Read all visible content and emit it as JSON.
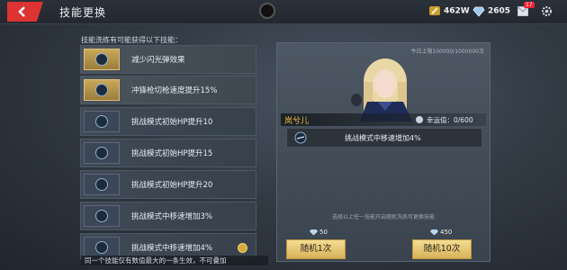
{
  "header": {
    "title": "技能更换",
    "currency_gold": "462W",
    "currency_gem": "2605",
    "mail_badge": "17"
  },
  "left": {
    "heading": "技能洗练有可能获得以下技能：",
    "skills": [
      {
        "label": "减少闪光弹效果",
        "active": true
      },
      {
        "label": "冲锋枪切枪速度提升15%",
        "active": true
      },
      {
        "label": "挑战模式初始HP提升10",
        "active": false
      },
      {
        "label": "挑战模式初始HP提升15",
        "active": false
      },
      {
        "label": "挑战模式初始HP提升20",
        "active": false
      },
      {
        "label": "挑战模式中移速增加3%",
        "active": false
      },
      {
        "label": "挑战模式中移速增加4%",
        "active": false
      }
    ],
    "footer_note": "同一个技能仅有数值最大的一条生效，不可叠加"
  },
  "right": {
    "draw_counter": "今日上限100000/1000000次",
    "character_name": "岚兮儿",
    "luck": "幸运值：0/600",
    "result_skill": "挑战模式中移速增加4%",
    "hint": "选择以上任一技能开启随机洗练可更换技能",
    "cost_1": "50",
    "cost_10": "450",
    "btn_1": "随机1次",
    "btn_10": "随机10次"
  },
  "colors": {
    "accent_red": "#dd3333",
    "gold_button": "#e3c16f",
    "name_yellow": "#f0c040"
  },
  "icons": [
    "back-arrow-icon",
    "gold-coin-icon",
    "diamond-icon",
    "mail-icon",
    "gear-icon",
    "skill-orb-icon",
    "clover-icon"
  ]
}
